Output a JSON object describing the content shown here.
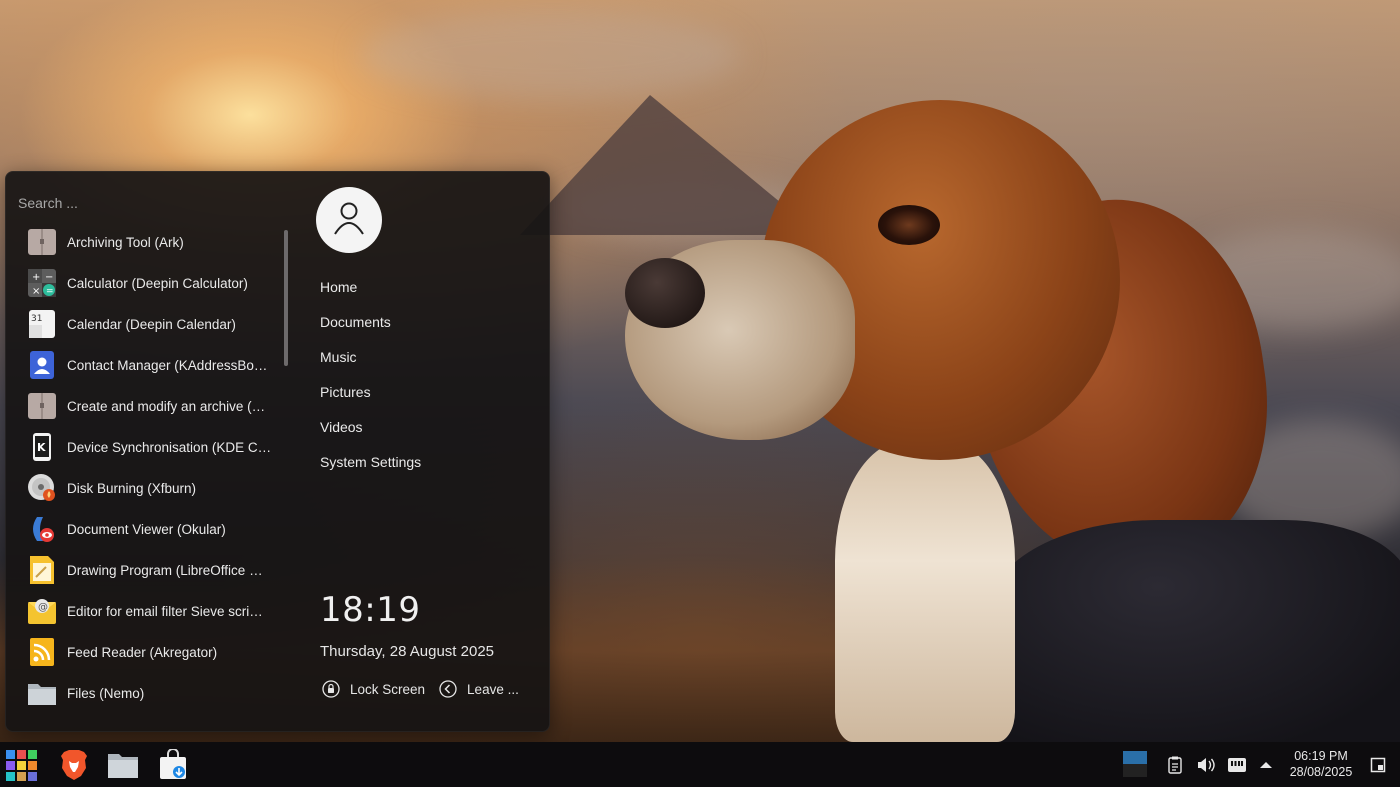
{
  "start_menu": {
    "search_placeholder": "Search ...",
    "apps": [
      {
        "label": "Archiving Tool (Ark)",
        "icon": "archive-icon"
      },
      {
        "label": "Calculator (Deepin Calculator)",
        "icon": "calculator-icon"
      },
      {
        "label": "Calendar (Deepin Calendar)",
        "icon": "calendar-icon"
      },
      {
        "label": "Contact Manager (KAddressBo…",
        "icon": "contact-icon"
      },
      {
        "label": "Create and modify an archive (…",
        "icon": "archive-icon"
      },
      {
        "label": "Device Synchronisation (KDE C…",
        "icon": "kde-connect-icon"
      },
      {
        "label": "Disk Burning (Xfburn)",
        "icon": "disc-icon"
      },
      {
        "label": "Document Viewer (Okular)",
        "icon": "okular-icon"
      },
      {
        "label": "Drawing Program (LibreOffice …",
        "icon": "drawing-icon"
      },
      {
        "label": "Editor for email filter Sieve scri…",
        "icon": "mail-filter-icon"
      },
      {
        "label": "Feed Reader (Akregator)",
        "icon": "rss-icon"
      },
      {
        "label": "Files (Nemo)",
        "icon": "folder-icon"
      }
    ],
    "places": [
      "Home",
      "Documents",
      "Music",
      "Pictures",
      "Videos",
      "System Settings"
    ],
    "clock_time": "18:19",
    "clock_date": "Thursday, 28 August 2025",
    "lock_label": "Lock Screen",
    "leave_label": "Leave ..."
  },
  "taskbar": {
    "launchers": [
      {
        "name": "start-menu-button",
        "icon": "app-grid-icon"
      },
      {
        "name": "brave-browser-button",
        "icon": "brave-lion-icon"
      },
      {
        "name": "file-manager-button",
        "icon": "folder-icon"
      },
      {
        "name": "software-store-button",
        "icon": "shopping-bag-icon"
      }
    ],
    "tray": [
      "workspace-switcher",
      "clipboard-icon",
      "volume-icon",
      "network-icon",
      "tray-expand-icon"
    ],
    "clock_time": "06:19 PM",
    "clock_date": "28/08/2025"
  },
  "colors": {
    "menu_bg": "#161314",
    "taskbar_bg": "#0d0c0e",
    "text": "#eaeaea"
  }
}
